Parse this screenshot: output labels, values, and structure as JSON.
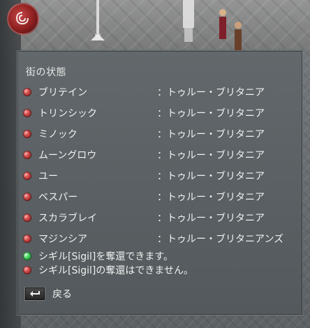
{
  "gump": {
    "title": "街の状態",
    "cities": [
      {
        "name": "ブリテイン",
        "status": "：トゥルー・ブリタニア",
        "gem": "red"
      },
      {
        "name": "トリンシック",
        "status": "：トゥルー・ブリタニア",
        "gem": "red"
      },
      {
        "name": "ミノック",
        "status": "：トゥルー・ブリタニア",
        "gem": "red"
      },
      {
        "name": "ムーングロウ",
        "status": "：トゥルー・ブリタニア",
        "gem": "red"
      },
      {
        "name": "ユー",
        "status": "：トゥルー・ブリタニア",
        "gem": "red"
      },
      {
        "name": "ベスパー",
        "status": "：トゥルー・ブリタニア",
        "gem": "red"
      },
      {
        "name": "スカラブレイ",
        "status": "：トゥルー・ブリタニア",
        "gem": "red"
      },
      {
        "name": "マジンシア",
        "status": "：トゥルー・ブリタニアンズ",
        "gem": "red"
      }
    ],
    "notes": [
      {
        "text": "シギル[Sigil]を奪還できます。",
        "gem": "green"
      },
      {
        "text": "シギル[Sigil]の奪還はできません。",
        "gem": "red"
      }
    ],
    "back_label": "戻る"
  },
  "colors": {
    "panel_bg": "#585f62",
    "text": "#f0f0f0",
    "gem_red": "#d04b4b",
    "gem_green": "#41d05a"
  }
}
